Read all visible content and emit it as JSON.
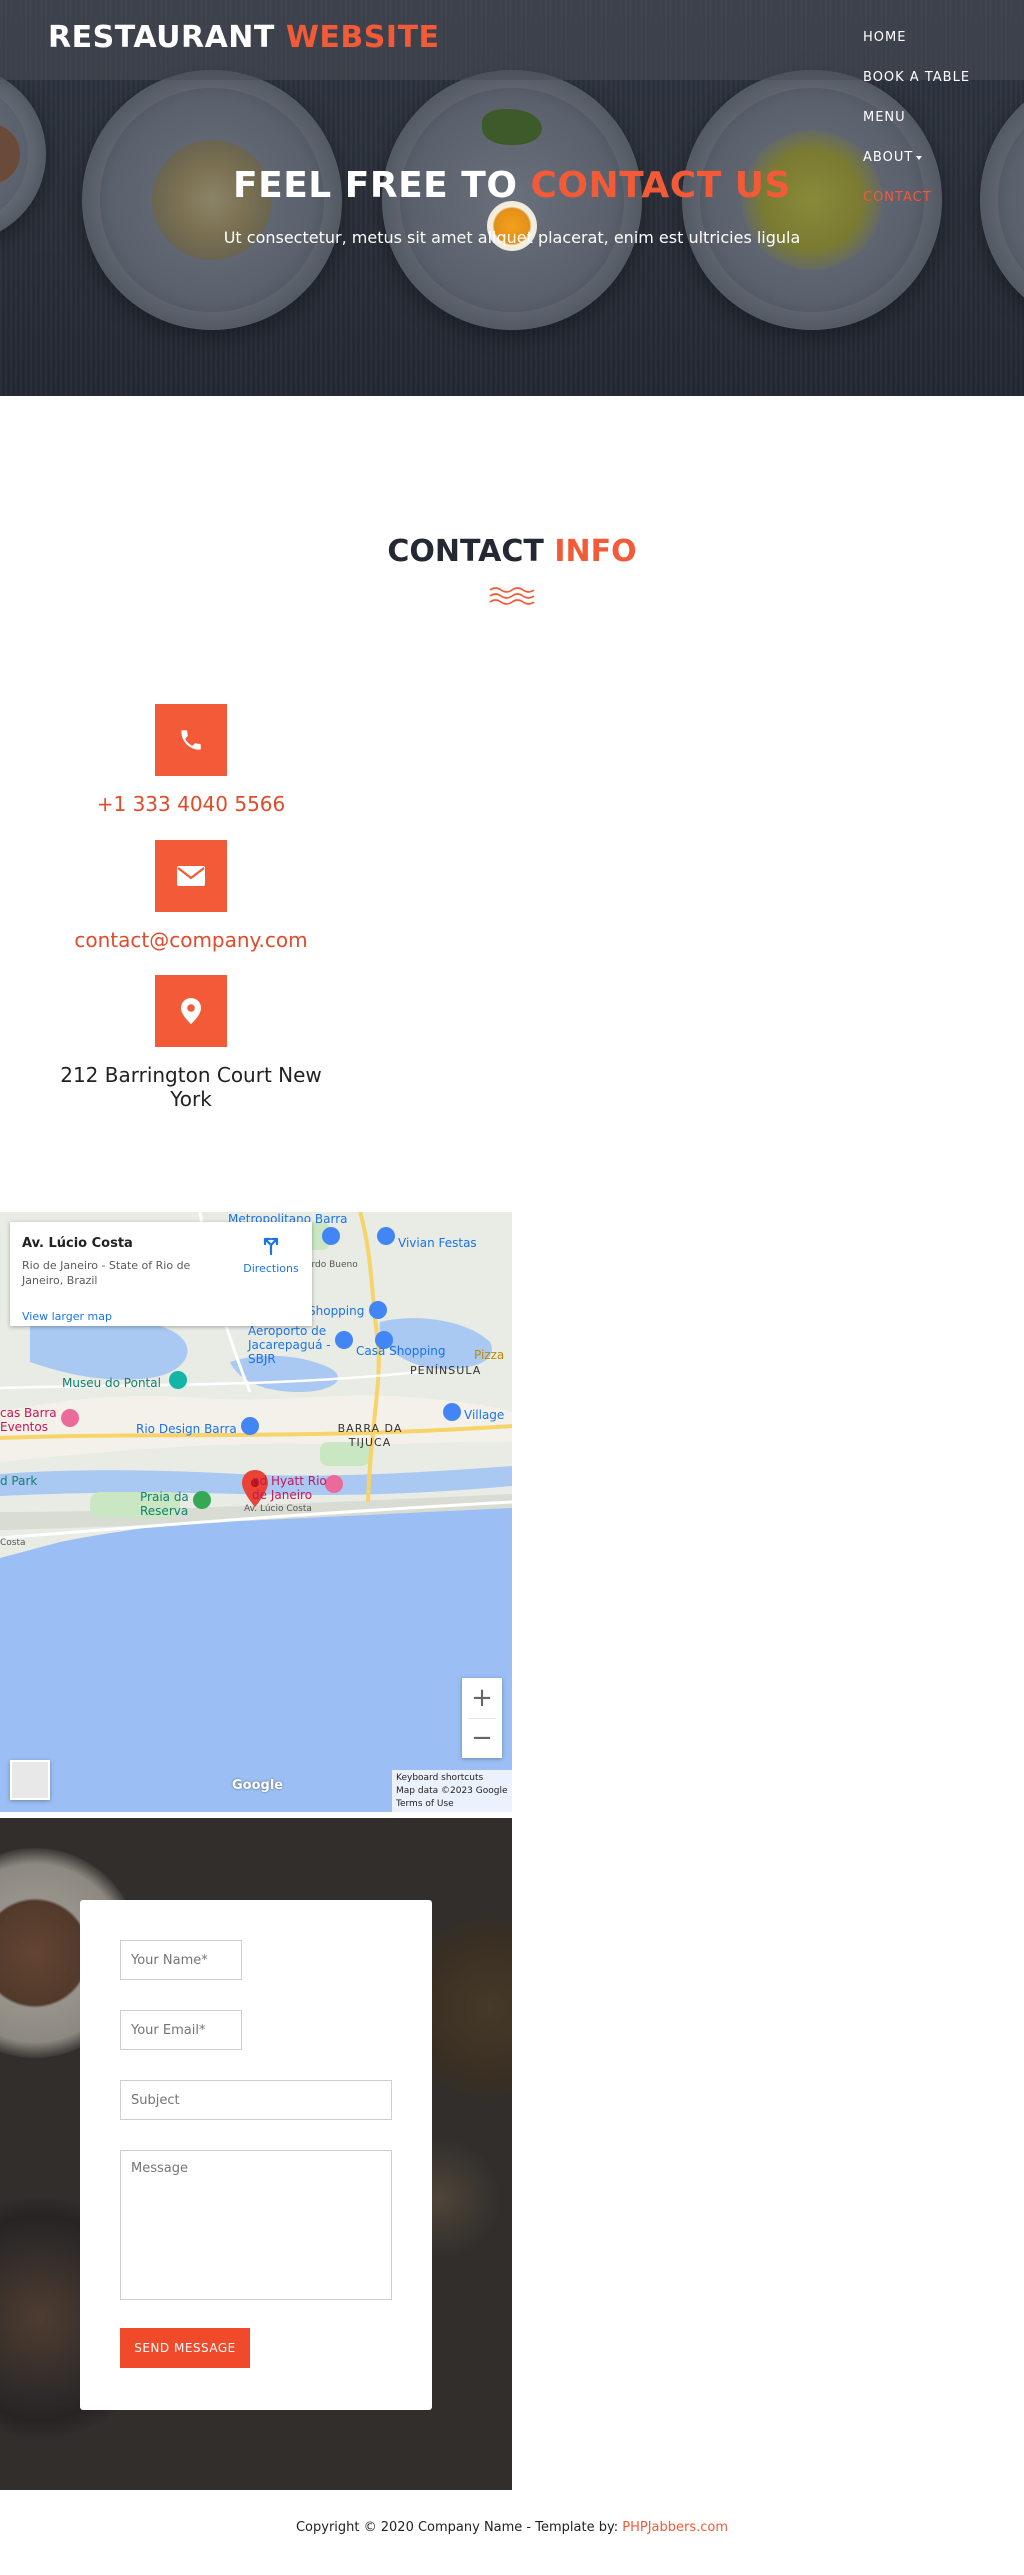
{
  "brand": {
    "name_part1": "RESTAURANT",
    "name_part2": "WEBSITE",
    "accent_color": "#f35a38"
  },
  "nav": {
    "items": [
      {
        "label": "HOME"
      },
      {
        "label": "BOOK A TABLE"
      },
      {
        "label": "MENU"
      },
      {
        "label": "ABOUT"
      },
      {
        "label": "CONTACT"
      }
    ],
    "active": "CONTACT"
  },
  "hero": {
    "title_part1": "FEEL FREE TO",
    "title_part2": "CONTACT US",
    "subtitle": "Ut consectetur, metus sit amet aliquet placerat, enim est ultricies ligula"
  },
  "contact_info": {
    "title_part1": "CONTACT",
    "title_part2": "INFO",
    "phone": "+1 333 4040 5566",
    "email": "contact@company.com",
    "address": "212 Barrington Court New York",
    "icons": [
      "phone-icon",
      "envelope-icon",
      "map-marker-icon"
    ]
  },
  "map": {
    "place_name": "Av. Lúcio Costa",
    "place_address": "Rio de Janeiro - State of Rio de Janeiro, Brazil",
    "directions_label": "Directions",
    "larger_map_label": "View larger map",
    "labels": {
      "metropolitano": "Metropolitano Barra",
      "vivian": "Vivian Festas",
      "bueno": "ardo Bueno",
      "shopping": "Shopping",
      "aeroporto": "Aeroporto de Jacarepaguá - SBJR",
      "casa_shopping": "Casa Shopping",
      "peninsula": "PENÍNSULA",
      "pizza": "Pizza",
      "museu": "Museu do Pontal",
      "cas_barra": "cas Barra Eventos",
      "rio_design": "Rio Design Barra",
      "barra_tijuca": "BARRA DA TIJUCA",
      "village": "Village",
      "park": "d Park",
      "praia": "Praia da Reserva",
      "grand_hyatt": "nd Hyatt Rio de Janeiro",
      "av_lucio": "Av. Lúcio Costa",
      "costa": "Costa"
    },
    "zoom_in": "+",
    "zoom_out": "−",
    "google_logo": "Google",
    "attribution": {
      "shortcuts": "Keyboard shortcuts",
      "data": "Map data ©2023 Google",
      "terms": "Terms of Use"
    }
  },
  "form": {
    "name_placeholder": "Your Name*",
    "email_placeholder": "Your Email*",
    "subject_placeholder": "Subject",
    "message_placeholder": "Message",
    "submit_label": "SEND MESSAGE"
  },
  "footer": {
    "copyright": "Copyright © 2020 Company Name - Template by: ",
    "credit_link": "PHPJabbers.com"
  }
}
